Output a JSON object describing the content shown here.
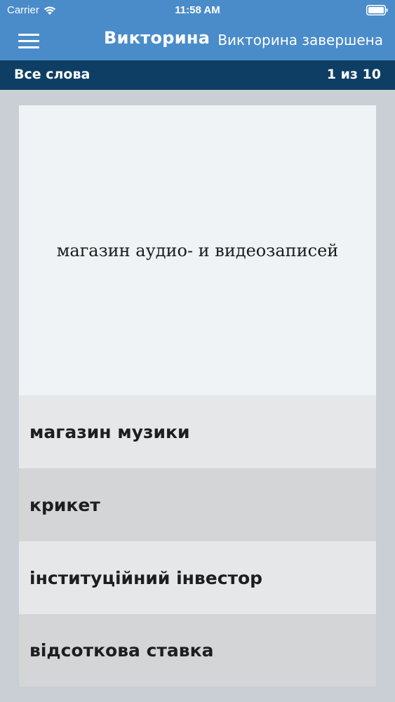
{
  "status_bar": {
    "carrier": "Carrier",
    "time": "11:58 AM",
    "wifi_icon": "wifi-icon",
    "battery_icon": "battery-icon"
  },
  "nav": {
    "menu_icon": "hamburger-menu-icon",
    "title": "Викторина",
    "subtitle": "Викторина завершена"
  },
  "sub_bar": {
    "left": "Все слова",
    "right": "1 из 10"
  },
  "question": {
    "text": "магазин аудио- и видеозаписей"
  },
  "answers": [
    {
      "label": "магазин музики"
    },
    {
      "label": "крикет"
    },
    {
      "label": "інституційний інвестор"
    },
    {
      "label": "відсоткова ставка"
    }
  ],
  "colors": {
    "nav_blue": "#4a8cc9",
    "sub_bar_navy": "#0e3e63",
    "background": "#c9cfd4",
    "card": "#f0f3f6",
    "answer_light": "#e6e7e9",
    "answer_dark": "#d4d5d7"
  }
}
